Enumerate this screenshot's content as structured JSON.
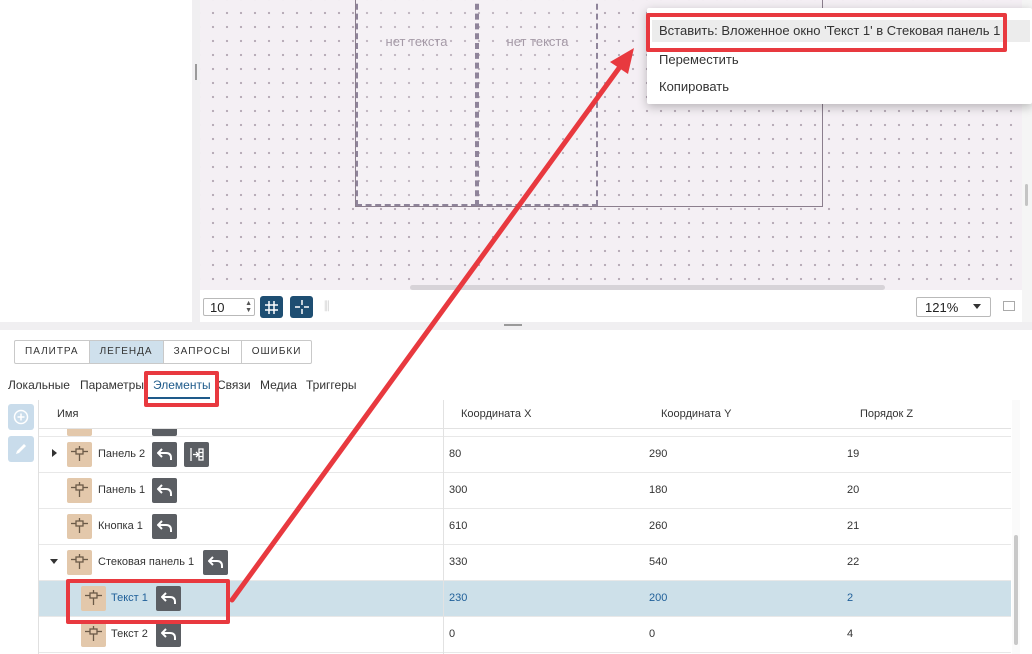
{
  "canvas": {
    "placeholders": [
      "нет текста",
      "нет текста"
    ],
    "grid_step_value": "10",
    "zoom": "121%"
  },
  "context_menu": {
    "items": [
      "Вставить: Вложенное окно 'Текст 1' в Стековая панель 1",
      "Переместить",
      "Копировать"
    ]
  },
  "main_tabs": [
    "ПАЛИТРА",
    "ЛЕГЕНДА",
    "ЗАПРОСЫ",
    "ОШИБКИ"
  ],
  "sub_tabs": [
    "Локальные",
    "Параметры",
    "Элементы",
    "Связи",
    "Медиа",
    "Триггеры"
  ],
  "table": {
    "headers": [
      "Имя",
      "Координата X",
      "Координата Y",
      "Порядок Z"
    ],
    "rows": [
      {
        "name": "Панель 2",
        "x": "80",
        "y": "290",
        "z": "19"
      },
      {
        "name": "Панель 1",
        "x": "300",
        "y": "180",
        "z": "20"
      },
      {
        "name": "Кнопка 1",
        "x": "610",
        "y": "260",
        "z": "21"
      },
      {
        "name": "Стековая панель 1",
        "x": "330",
        "y": "540",
        "z": "22"
      },
      {
        "name": "Текст 1",
        "x": "230",
        "y": "200",
        "z": "2"
      },
      {
        "name": "Текст 2",
        "x": "0",
        "y": "0",
        "z": "4"
      }
    ]
  },
  "colors": {
    "accent": "#1e4e72",
    "selected_row": "#cde0e9",
    "annotation": "#e8393f",
    "node_icon": "#e3c8ab"
  }
}
